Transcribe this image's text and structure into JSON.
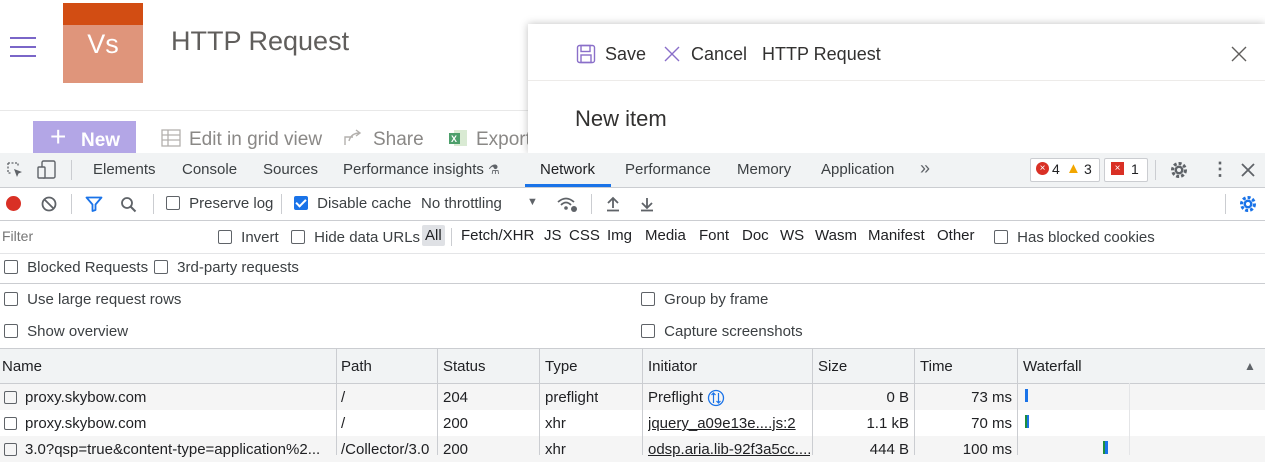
{
  "site": {
    "logo_text": "Vs",
    "title": "HTTP Request",
    "commands": {
      "new": "New",
      "edit_grid": "Edit in grid view",
      "share": "Share",
      "export": "Export"
    }
  },
  "panel": {
    "save": "Save",
    "cancel": "Cancel",
    "title": "HTTP Request",
    "heading": "New item"
  },
  "devtools": {
    "tabs": [
      "Elements",
      "Console",
      "Sources",
      "Performance insights",
      "Network",
      "Performance",
      "Memory",
      "Application"
    ],
    "more_tabs": "»",
    "errors": "4",
    "warnings": "3",
    "issues": "1",
    "toolbar": {
      "preserve_log": "Preserve log",
      "disable_cache": "Disable cache",
      "throttling": "No throttling"
    },
    "filter": {
      "placeholder": "Filter",
      "invert": "Invert",
      "hide_data_urls": "Hide data URLs",
      "types": [
        "All",
        "Fetch/XHR",
        "JS",
        "CSS",
        "Img",
        "Media",
        "Font",
        "Doc",
        "WS",
        "Wasm",
        "Manifest",
        "Other"
      ],
      "has_blocked_cookies": "Has blocked cookies",
      "blocked_requests": "Blocked Requests",
      "third_party": "3rd-party requests"
    },
    "options": {
      "large_rows": "Use large request rows",
      "group_by_frame": "Group by frame",
      "show_overview": "Show overview",
      "capture_screenshots": "Capture screenshots"
    },
    "table": {
      "columns": [
        "Name",
        "Path",
        "Status",
        "Type",
        "Initiator",
        "Size",
        "Time",
        "Waterfall"
      ],
      "sort_arrow": "▲",
      "rows": [
        {
          "name": "proxy.skybow.com",
          "path": "/",
          "status": "204",
          "type": "preflight",
          "initiator": "Preflight",
          "size": "0 B",
          "time": "73 ms"
        },
        {
          "name": "proxy.skybow.com",
          "path": "/",
          "status": "200",
          "type": "xhr",
          "initiator": "jquery_a09e13e....js:2",
          "size": "1.1 kB",
          "time": "70 ms"
        },
        {
          "name": "3.0?qsp=true&content-type=application%2...",
          "path": "/Collector/3.0",
          "status": "200",
          "type": "xhr",
          "initiator": "odsp.aria.lib-92f3a5cc....",
          "size": "444 B",
          "time": "100 ms"
        }
      ]
    }
  },
  "colors": {
    "accent": "#1a73e8",
    "record_red": "#d93025",
    "brand_purple": "#b3a6e6",
    "logo_orange": "#df957b"
  }
}
